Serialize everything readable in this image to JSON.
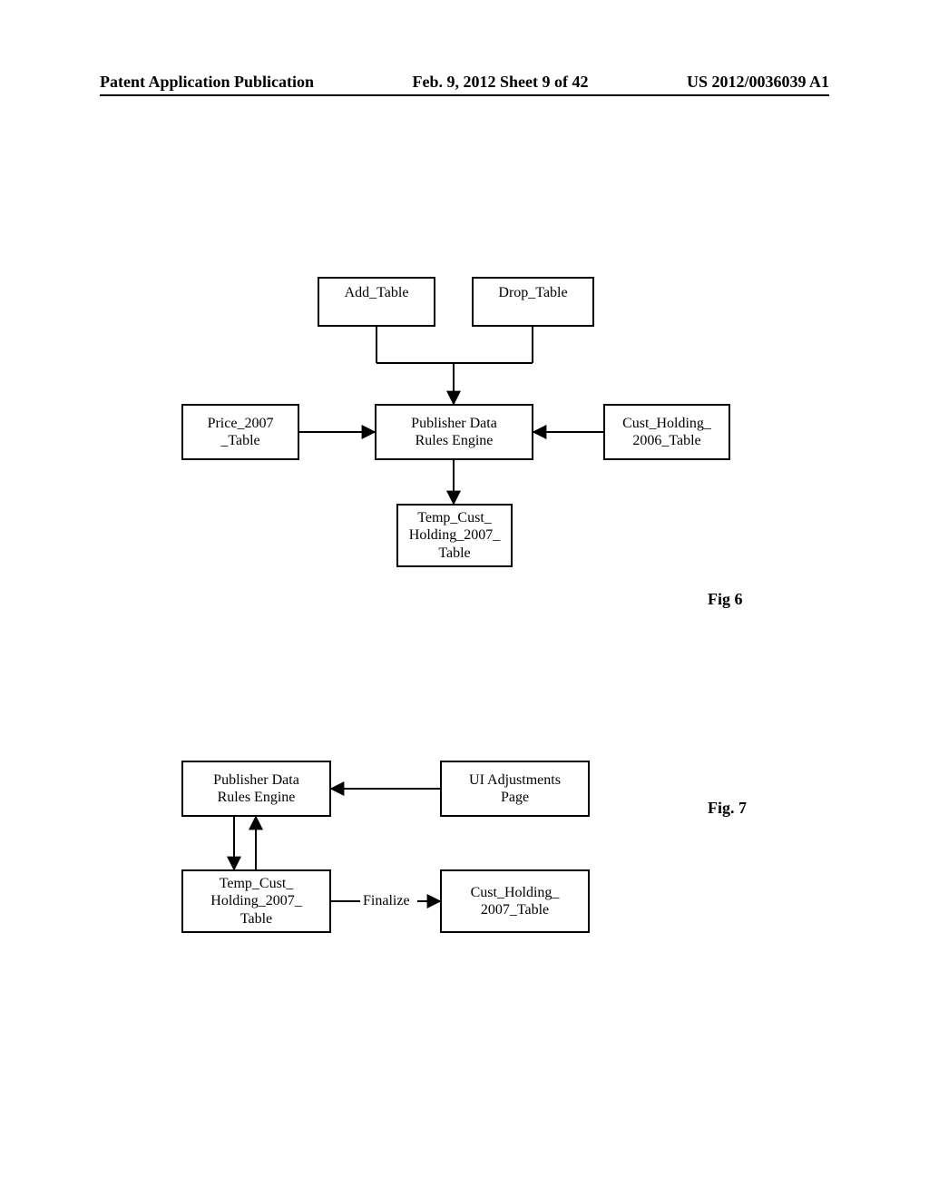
{
  "header": {
    "left": "Patent Application Publication",
    "center": "Feb. 9, 2012  Sheet 9 of 42",
    "right": "US 2012/0036039 A1"
  },
  "fig6": {
    "label": "Fig 6",
    "boxes": {
      "add_table": "Add_Table",
      "drop_table": "Drop_Table",
      "price_2007": "Price_2007\n_Table",
      "rules_engine": "Publisher Data\nRules Engine",
      "cust_holding_2006": "Cust_Holding_\n2006_Table",
      "temp_cust_2007": "Temp_Cust_\nHolding_2007_\nTable"
    }
  },
  "fig7": {
    "label": "Fig. 7",
    "boxes": {
      "rules_engine": "Publisher Data\nRules Engine",
      "ui_adjustments": "UI Adjustments\nPage",
      "temp_cust_2007": "Temp_Cust_\nHolding_2007_\nTable",
      "cust_holding_2007": "Cust_Holding_\n2007_Table"
    },
    "edge_label": "Finalize"
  }
}
